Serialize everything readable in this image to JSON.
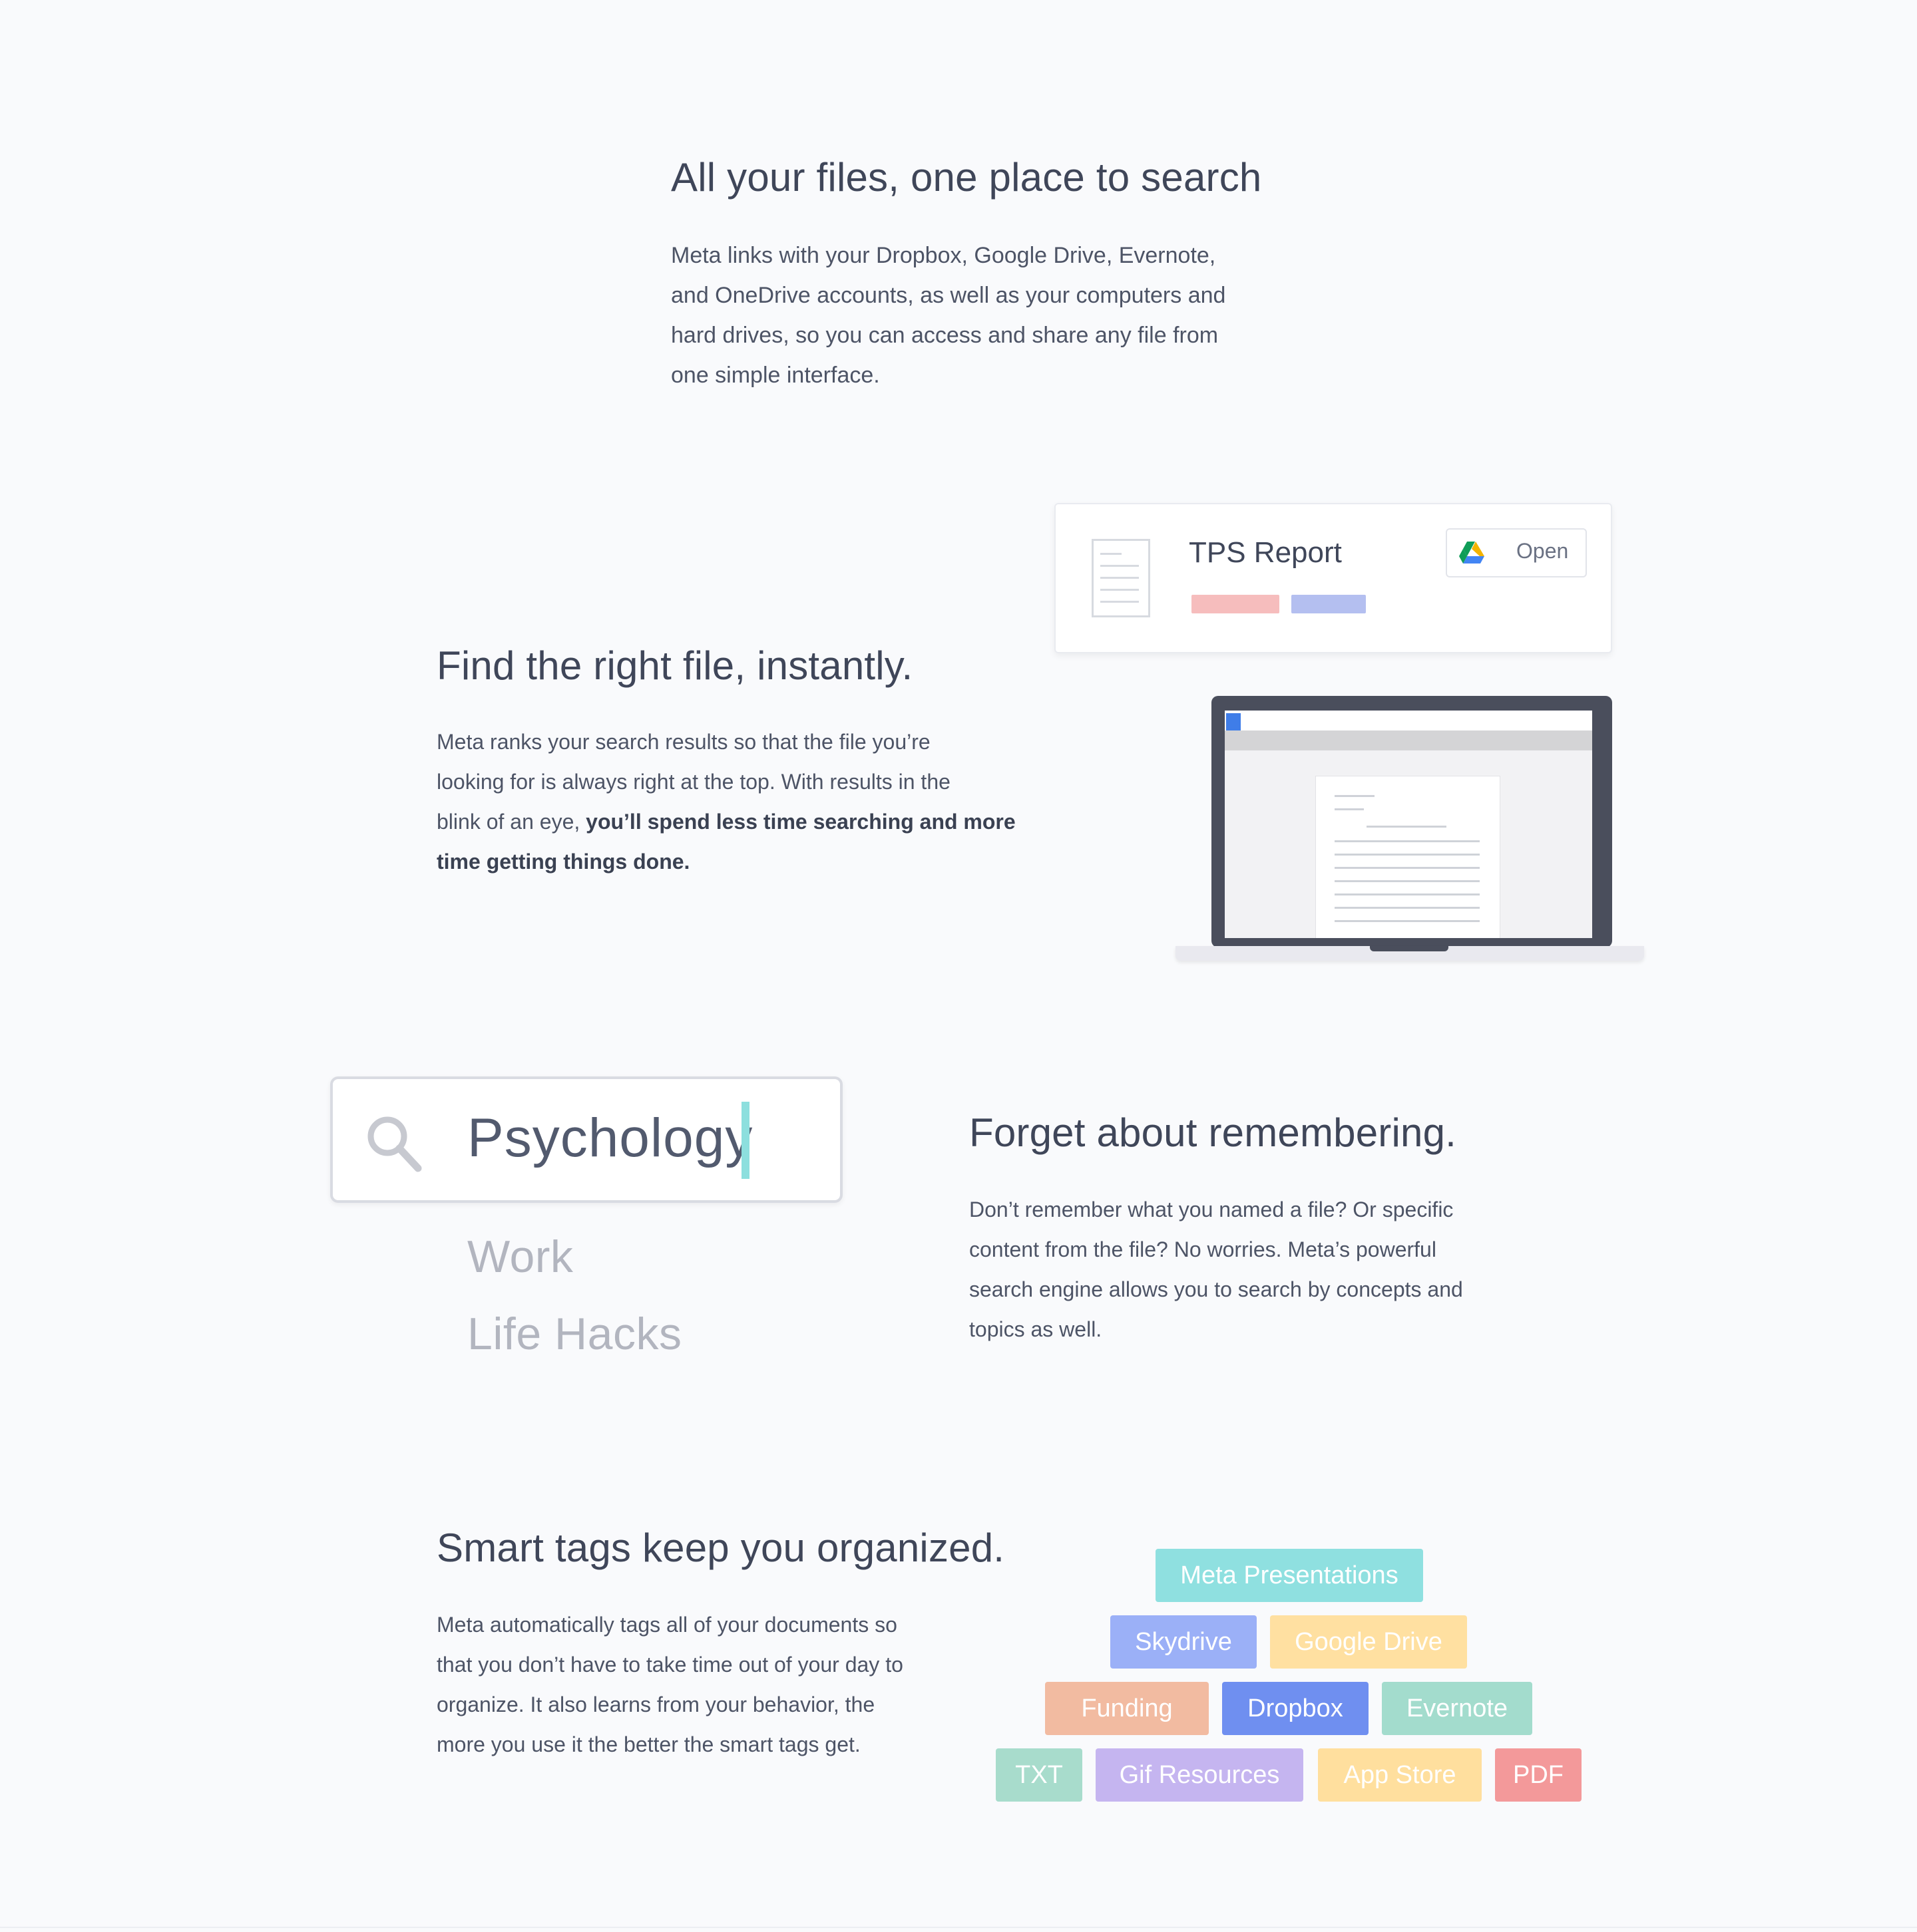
{
  "section1": {
    "title": "All your files, one place to search",
    "body_lines": [
      "Meta links with your Dropbox, Google Drive, Evernote,",
      "and OneDrive accounts, as well as your computers and",
      "hard drives, so you can access and share any file from",
      "one simple interface."
    ]
  },
  "section2": {
    "title": "Find the right file, instantly.",
    "body_lines": [
      "Meta ranks your search results so that the file you’re",
      "looking for is always right at the top. With results in the"
    ],
    "body_line3_plain": "blink of an eye, ",
    "body_line3_bold": "you’ll spend less time searching and more",
    "body_line4_bold": "time getting things done.",
    "card": {
      "file_name": "TPS Report",
      "open_label": "Open",
      "icon": "google-drive-icon",
      "tag_colors": [
        "#f6bdbd",
        "#b4bff0"
      ]
    }
  },
  "section3": {
    "title": "Forget about remembering.",
    "body_lines": [
      "Don’t remember what you named a file? Or specific",
      "content from the file?  No worries. Meta’s powerful",
      "search engine allows you to search by concepts and",
      "topics as well."
    ],
    "search": {
      "query": "Psychology",
      "icon": "search-icon",
      "suggestions": [
        "Work",
        "Life Hacks"
      ]
    }
  },
  "section4": {
    "title": "Smart tags keep you organized.",
    "body_lines": [
      "Meta automatically tags all of your documents so",
      "that you don’t have to take time out of your day to",
      "organize. It also learns from your behavior, the",
      "more you use it the better the smart tags get."
    ],
    "tags": [
      {
        "label": "Meta Presentations",
        "color": "#8fe0e0"
      },
      {
        "label": "Skydrive",
        "color": "#9bb0f7"
      },
      {
        "label": "Google Drive",
        "color": "#ffe0a1"
      },
      {
        "label": "Funding",
        "color": "#f2bba1"
      },
      {
        "label": "Dropbox",
        "color": "#6f8ff0"
      },
      {
        "label": "Evernote",
        "color": "#a3dccd"
      },
      {
        "label": "TXT",
        "color": "#a8dccc"
      },
      {
        "label": "Gif Resources",
        "color": "#c5b5f0"
      },
      {
        "label": "App Store",
        "color": "#ffdf9e"
      },
      {
        "label": "PDF",
        "color": "#f3999a"
      }
    ]
  }
}
